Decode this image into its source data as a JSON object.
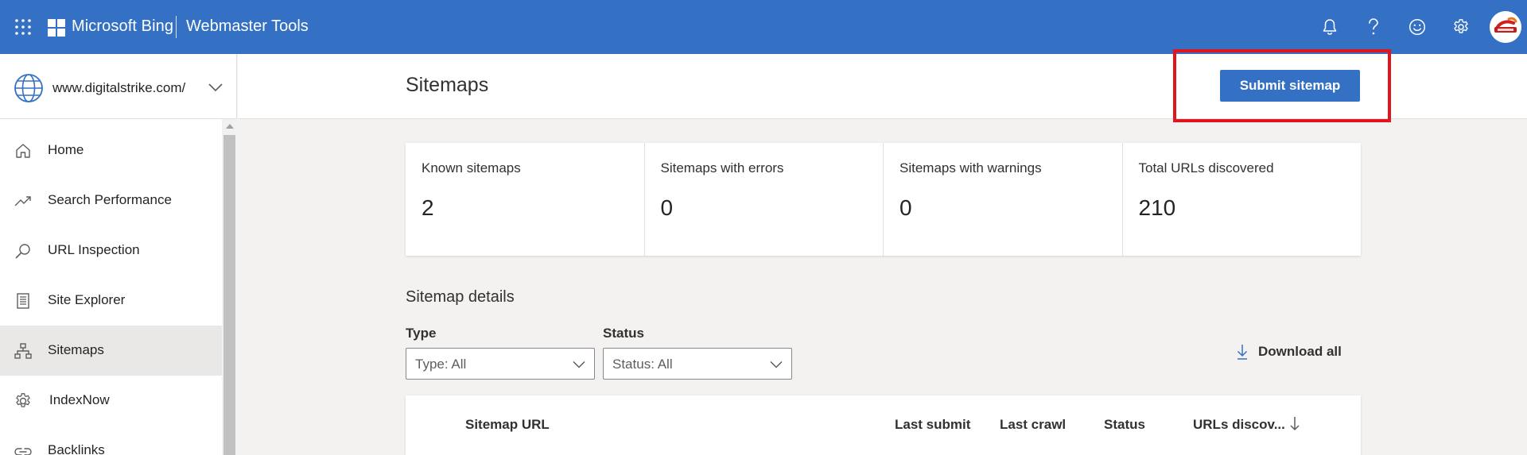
{
  "header": {
    "brand": "Microsoft Bing",
    "product": "Webmaster Tools",
    "icons": [
      "waffle-icon",
      "bell-icon",
      "help-icon",
      "feedback-icon",
      "settings-icon",
      "avatar"
    ]
  },
  "sidebar": {
    "site": "www.digitalstrike.com/",
    "items": [
      {
        "label": "Home",
        "icon": "home-icon"
      },
      {
        "label": "Search Performance",
        "icon": "trend-icon"
      },
      {
        "label": "URL Inspection",
        "icon": "search-icon"
      },
      {
        "label": "Site Explorer",
        "icon": "document-icon"
      },
      {
        "label": "Sitemaps",
        "icon": "sitemap-icon",
        "active": true
      },
      {
        "label": "IndexNow",
        "icon": "indexnow-icon"
      },
      {
        "label": "Backlinks",
        "icon": "link-icon"
      }
    ]
  },
  "page": {
    "title": "Sitemaps",
    "submit_label": "Submit sitemap"
  },
  "stats": [
    {
      "label": "Known sitemaps",
      "value": "2"
    },
    {
      "label": "Sitemaps with errors",
      "value": "0"
    },
    {
      "label": "Sitemaps with warnings",
      "value": "0"
    },
    {
      "label": "Total URLs discovered",
      "value": "210"
    }
  ],
  "details": {
    "title": "Sitemap details",
    "type_label": "Type",
    "type_value": "Type: All",
    "status_label": "Status",
    "status_value": "Status: All",
    "download_label": "Download all",
    "columns": [
      "Sitemap URL",
      "Last submit",
      "Last crawl",
      "Status",
      "URLs discov..."
    ]
  },
  "colors": {
    "accent": "#3470c3",
    "highlight": "#e0151d"
  }
}
